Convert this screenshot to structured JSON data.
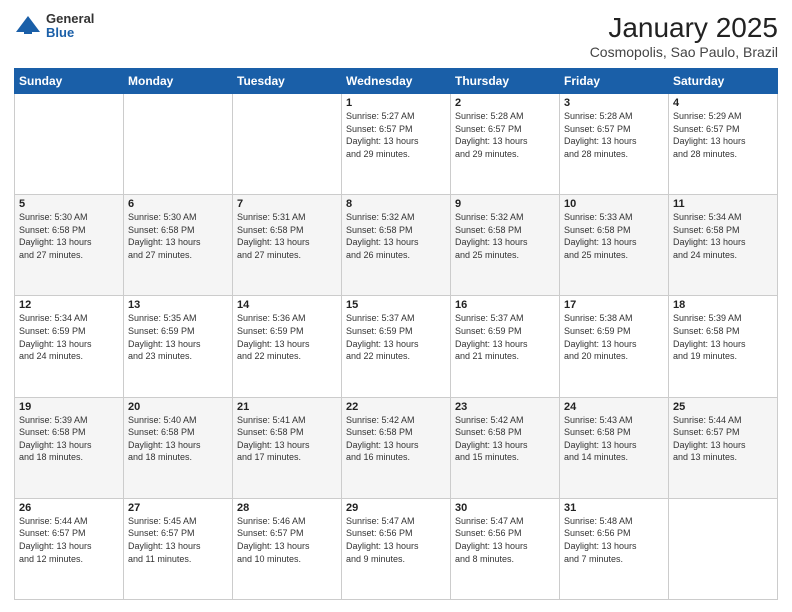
{
  "logo": {
    "general": "General",
    "blue": "Blue"
  },
  "title": "January 2025",
  "subtitle": "Cosmopolis, Sao Paulo, Brazil",
  "days_header": [
    "Sunday",
    "Monday",
    "Tuesday",
    "Wednesday",
    "Thursday",
    "Friday",
    "Saturday"
  ],
  "weeks": [
    [
      {
        "day": "",
        "info": ""
      },
      {
        "day": "",
        "info": ""
      },
      {
        "day": "",
        "info": ""
      },
      {
        "day": "1",
        "info": "Sunrise: 5:27 AM\nSunset: 6:57 PM\nDaylight: 13 hours\nand 29 minutes."
      },
      {
        "day": "2",
        "info": "Sunrise: 5:28 AM\nSunset: 6:57 PM\nDaylight: 13 hours\nand 29 minutes."
      },
      {
        "day": "3",
        "info": "Sunrise: 5:28 AM\nSunset: 6:57 PM\nDaylight: 13 hours\nand 28 minutes."
      },
      {
        "day": "4",
        "info": "Sunrise: 5:29 AM\nSunset: 6:57 PM\nDaylight: 13 hours\nand 28 minutes."
      }
    ],
    [
      {
        "day": "5",
        "info": "Sunrise: 5:30 AM\nSunset: 6:58 PM\nDaylight: 13 hours\nand 27 minutes."
      },
      {
        "day": "6",
        "info": "Sunrise: 5:30 AM\nSunset: 6:58 PM\nDaylight: 13 hours\nand 27 minutes."
      },
      {
        "day": "7",
        "info": "Sunrise: 5:31 AM\nSunset: 6:58 PM\nDaylight: 13 hours\nand 27 minutes."
      },
      {
        "day": "8",
        "info": "Sunrise: 5:32 AM\nSunset: 6:58 PM\nDaylight: 13 hours\nand 26 minutes."
      },
      {
        "day": "9",
        "info": "Sunrise: 5:32 AM\nSunset: 6:58 PM\nDaylight: 13 hours\nand 25 minutes."
      },
      {
        "day": "10",
        "info": "Sunrise: 5:33 AM\nSunset: 6:58 PM\nDaylight: 13 hours\nand 25 minutes."
      },
      {
        "day": "11",
        "info": "Sunrise: 5:34 AM\nSunset: 6:58 PM\nDaylight: 13 hours\nand 24 minutes."
      }
    ],
    [
      {
        "day": "12",
        "info": "Sunrise: 5:34 AM\nSunset: 6:59 PM\nDaylight: 13 hours\nand 24 minutes."
      },
      {
        "day": "13",
        "info": "Sunrise: 5:35 AM\nSunset: 6:59 PM\nDaylight: 13 hours\nand 23 minutes."
      },
      {
        "day": "14",
        "info": "Sunrise: 5:36 AM\nSunset: 6:59 PM\nDaylight: 13 hours\nand 22 minutes."
      },
      {
        "day": "15",
        "info": "Sunrise: 5:37 AM\nSunset: 6:59 PM\nDaylight: 13 hours\nand 22 minutes."
      },
      {
        "day": "16",
        "info": "Sunrise: 5:37 AM\nSunset: 6:59 PM\nDaylight: 13 hours\nand 21 minutes."
      },
      {
        "day": "17",
        "info": "Sunrise: 5:38 AM\nSunset: 6:59 PM\nDaylight: 13 hours\nand 20 minutes."
      },
      {
        "day": "18",
        "info": "Sunrise: 5:39 AM\nSunset: 6:58 PM\nDaylight: 13 hours\nand 19 minutes."
      }
    ],
    [
      {
        "day": "19",
        "info": "Sunrise: 5:39 AM\nSunset: 6:58 PM\nDaylight: 13 hours\nand 18 minutes."
      },
      {
        "day": "20",
        "info": "Sunrise: 5:40 AM\nSunset: 6:58 PM\nDaylight: 13 hours\nand 18 minutes."
      },
      {
        "day": "21",
        "info": "Sunrise: 5:41 AM\nSunset: 6:58 PM\nDaylight: 13 hours\nand 17 minutes."
      },
      {
        "day": "22",
        "info": "Sunrise: 5:42 AM\nSunset: 6:58 PM\nDaylight: 13 hours\nand 16 minutes."
      },
      {
        "day": "23",
        "info": "Sunrise: 5:42 AM\nSunset: 6:58 PM\nDaylight: 13 hours\nand 15 minutes."
      },
      {
        "day": "24",
        "info": "Sunrise: 5:43 AM\nSunset: 6:58 PM\nDaylight: 13 hours\nand 14 minutes."
      },
      {
        "day": "25",
        "info": "Sunrise: 5:44 AM\nSunset: 6:57 PM\nDaylight: 13 hours\nand 13 minutes."
      }
    ],
    [
      {
        "day": "26",
        "info": "Sunrise: 5:44 AM\nSunset: 6:57 PM\nDaylight: 13 hours\nand 12 minutes."
      },
      {
        "day": "27",
        "info": "Sunrise: 5:45 AM\nSunset: 6:57 PM\nDaylight: 13 hours\nand 11 minutes."
      },
      {
        "day": "28",
        "info": "Sunrise: 5:46 AM\nSunset: 6:57 PM\nDaylight: 13 hours\nand 10 minutes."
      },
      {
        "day": "29",
        "info": "Sunrise: 5:47 AM\nSunset: 6:56 PM\nDaylight: 13 hours\nand 9 minutes."
      },
      {
        "day": "30",
        "info": "Sunrise: 5:47 AM\nSunset: 6:56 PM\nDaylight: 13 hours\nand 8 minutes."
      },
      {
        "day": "31",
        "info": "Sunrise: 5:48 AM\nSunset: 6:56 PM\nDaylight: 13 hours\nand 7 minutes."
      },
      {
        "day": "",
        "info": ""
      }
    ]
  ]
}
